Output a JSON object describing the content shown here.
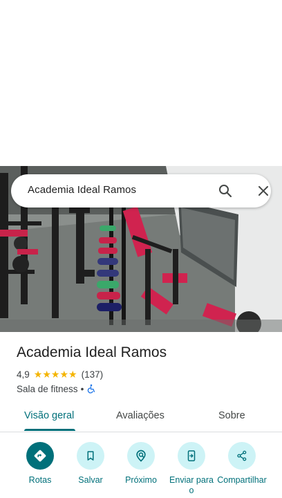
{
  "search": {
    "query": "Academia Ideal Ramos",
    "search_icon": "search-icon",
    "close_icon": "close-icon"
  },
  "place": {
    "title": "Academia Ideal Ramos",
    "rating": "4,9",
    "rating_fraction": 0.98,
    "review_count": "(137)",
    "category": "Sala de fitness",
    "separator": "•",
    "accessibility_icon": "wheelchair-icon"
  },
  "tabs": [
    {
      "label": "Visão geral",
      "active": true
    },
    {
      "label": "Avaliações",
      "active": false
    },
    {
      "label": "Sobre",
      "active": false
    }
  ],
  "actions": [
    {
      "label": "Rotas",
      "icon": "directions-icon"
    },
    {
      "label": "Salvar",
      "icon": "bookmark-icon"
    },
    {
      "label": "Próximo",
      "icon": "nearby-icon"
    },
    {
      "label": "Enviar para o",
      "icon": "send-to-phone-icon"
    },
    {
      "label": "Compartilhar",
      "icon": "share-icon"
    }
  ],
  "colors": {
    "accent": "#00707a",
    "action_bg": "#cdf3f6",
    "star": "#f4b400"
  }
}
